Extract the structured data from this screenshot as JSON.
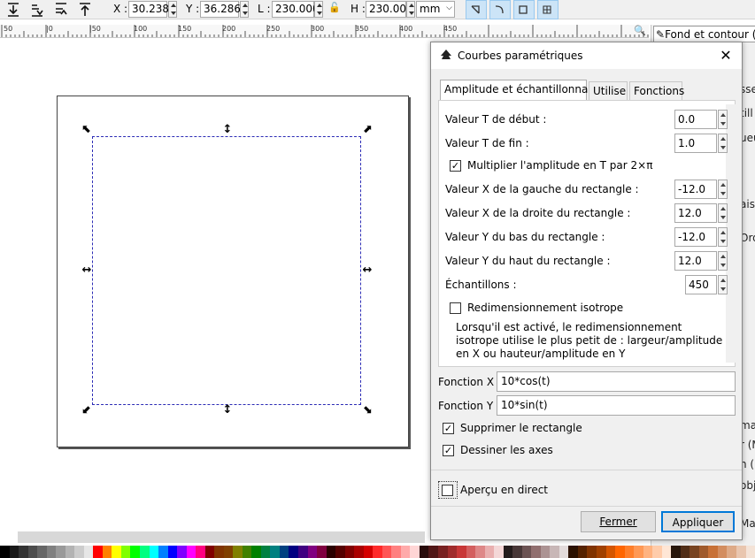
{
  "toolbar": {
    "x_label": "X :",
    "x_value": "30.238",
    "y_label": "Y :",
    "y_value": "36.286",
    "w_label": "L :",
    "w_value": "230.000",
    "h_label": "H :",
    "h_value": "230.000",
    "unit": "mm",
    "lock_icon": "lock-icon"
  },
  "ruler": {
    "ticks": [
      "50",
      "|0",
      "|50",
      "100",
      "150",
      "200",
      "250",
      "300",
      "350",
      "400",
      "450"
    ]
  },
  "rightpanel": {
    "title": "Fond et contour (M",
    "fragments": [
      "sse",
      "till",
      "ueu",
      "aiso",
      "Ord",
      "ma",
      "r (M",
      "n (",
      "obj",
      "Maj+"
    ]
  },
  "dialog": {
    "title": "Courbes paramétriques",
    "tabs": [
      "Amplitude et échantillonnage",
      "Utiliser",
      "Fonctions"
    ],
    "fields": [
      {
        "label": "Valeur T de début :",
        "value": "0.0"
      },
      {
        "label": "Valeur T de fin :",
        "value": "1.0"
      },
      {
        "label": "Valeur X de la gauche du rectangle :",
        "value": "-12.0"
      },
      {
        "label": "Valeur X de la droite du rectangle :",
        "value": "12.0"
      },
      {
        "label": "Valeur Y du bas du rectangle :",
        "value": "-12.0"
      },
      {
        "label": "Valeur Y du haut du rectangle :",
        "value": "12.0"
      }
    ],
    "multiply_label": "Multiplier l'amplitude en T par 2×π",
    "samples_label": "Échantillons :",
    "samples_value": "450",
    "isotropic_label": "Redimensionnement isotrope",
    "isotropic_help": [
      "Lorsqu'il est activé, le redimensionnement",
      "isotrope utilise le plus petit de : largeur/amplitude",
      "en X ou hauteur/amplitude en Y"
    ],
    "fx_label": "Fonction X :",
    "fx_value": "10*cos(t)",
    "fy_label": "Fonction Y :",
    "fy_value": "10*sin(t)",
    "remove_rect_label": "Supprimer le rectangle",
    "draw_axes_label": "Dessiner les axes",
    "live_preview_label": "Aperçu en direct",
    "close_button": "Fermer",
    "apply_button": "Appliquer"
  },
  "colors": {
    "accent": "#0078d7",
    "selection": "#2b2bb5"
  },
  "palette": [
    "#000000",
    "#1a1a1a",
    "#333333",
    "#4d4d4d",
    "#666666",
    "#808080",
    "#999999",
    "#b3b3b3",
    "#cccccc",
    "#e6e6e6",
    "#ff0000",
    "#ff8000",
    "#ffff00",
    "#80ff00",
    "#00ff00",
    "#00ff80",
    "#00ffff",
    "#0080ff",
    "#0000ff",
    "#8000ff",
    "#ff00ff",
    "#ff0080",
    "#800000",
    "#803300",
    "#804000",
    "#808000",
    "#408000",
    "#008000",
    "#008040",
    "#008080",
    "#004080",
    "#000080",
    "#400080",
    "#800080",
    "#800040",
    "#2b0000",
    "#550000",
    "#800000",
    "#aa0000",
    "#d40000",
    "#ff2a2a",
    "#ff5555",
    "#ff8080",
    "#ffaaaa",
    "#ffd5d5",
    "#280b0b",
    "#501616",
    "#782121",
    "#a02c2c",
    "#c83737",
    "#d35f5f",
    "#de8787",
    "#e9afaf",
    "#f4d7d7",
    "#241c1c",
    "#483737",
    "#6c5353",
    "#916f6f",
    "#ac9393",
    "#c8b7b7",
    "#e3dbdb",
    "#2b1100",
    "#552200",
    "#803300",
    "#a04000",
    "#d45500",
    "#ff6600",
    "#ff7f2a",
    "#ff9955",
    "#ffb380",
    "#ffccaa",
    "#ffe6d5",
    "#28170b",
    "#502d16",
    "#784421",
    "#a05a2c",
    "#c87137",
    "#d38d5f",
    "#deaa87",
    "#e9c6af",
    "#f4e3d7"
  ]
}
